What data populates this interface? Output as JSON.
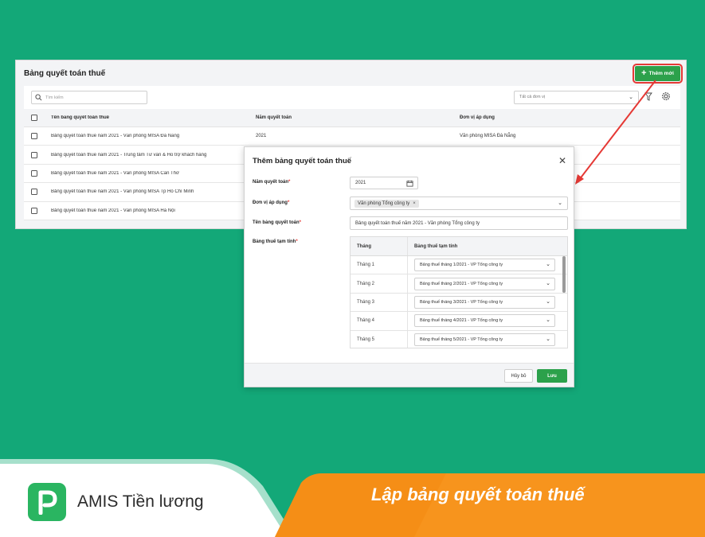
{
  "screen": {
    "title": "Bảng quyết toán thuế",
    "add_button": "Thêm mới",
    "search_placeholder": "Tìm kiếm",
    "unit_filter": "Tất cả đơn vị",
    "columns": [
      "Tên bảng quyết toán thuế",
      "Năm quyết toán",
      "Đơn vị áp dụng"
    ],
    "rows": [
      {
        "name": "Bảng quyết toán thuế năm 2021 - Văn phòng MISA Đà Nẵng",
        "year": "2021",
        "unit": "Văn phòng MISA Đà Nẵng"
      },
      {
        "name": "Bảng quyết toán thuế năm 2021 - Trung tâm Tư vấn & Hỗ trợ khách hàng",
        "year": "",
        "unit": ""
      },
      {
        "name": "Bảng quyết toán thuế năm 2021 - Văn phòng MISA Cần Thơ",
        "year": "",
        "unit": ""
      },
      {
        "name": "Bảng quyết toán thuế năm 2021 - Văn phòng MISA Tp Hồ Chí Minh",
        "year": "",
        "unit": ""
      },
      {
        "name": "Bảng quyết toán thuế năm 2021 - Văn phòng MISA Hà Nội",
        "year": "",
        "unit": ""
      }
    ]
  },
  "modal": {
    "title": "Thêm bảng quyết toán thuế",
    "year_label": "Năm quyết toán",
    "year_value": "2021",
    "unit_label": "Đơn vị áp dụng",
    "unit_tag": "Văn phòng Tổng công ty",
    "name_label": "Tên bảng quyết toán",
    "name_value": "Bảng quyết toán thuế năm 2021 - Văn phòng Tổng công ty",
    "grid_label": "Bảng thuế tạm tính",
    "grid_columns": [
      "Tháng",
      "Bảng thuế tạm tính"
    ],
    "grid_rows": [
      {
        "month": "Tháng 1",
        "table": "Bảng thuế tháng 1/2021 - VP Tổng công ty"
      },
      {
        "month": "Tháng 2",
        "table": "Bảng thuế tháng 2/2021 - VP Tổng công ty"
      },
      {
        "month": "Tháng 3",
        "table": "Bảng thuế tháng 3/2021 - VP Tổng công ty"
      },
      {
        "month": "Tháng 4",
        "table": "Bảng thuế tháng 4/2021 - VP Tổng công ty"
      },
      {
        "month": "Tháng 5",
        "table": "Bảng thuế tháng 5/2021 - VP Tổng công ty"
      }
    ],
    "cancel_label": "Hủy bỏ",
    "save_label": "Lưu"
  },
  "banner": {
    "brand": "AMIS Tiền lương",
    "headline": "Lập bảng quyết toán thuế"
  },
  "colors": {
    "background": "#13a878",
    "accent_green": "#2ca14b",
    "highlight_red": "#e53935",
    "banner_orange": "#f7941d"
  }
}
